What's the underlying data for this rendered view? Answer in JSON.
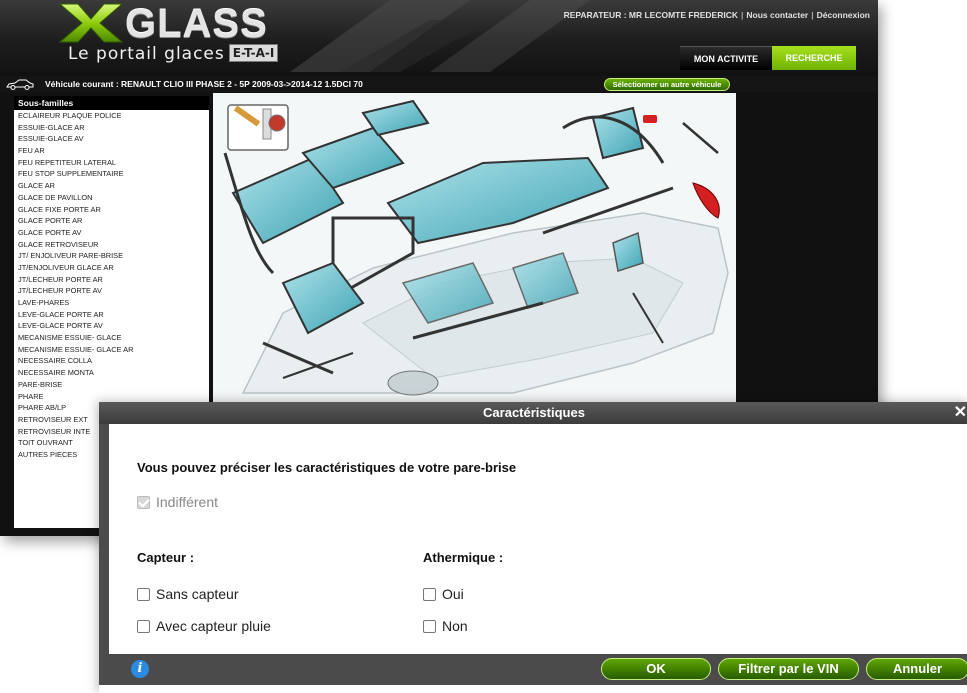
{
  "app": {
    "logo_text": "GLASS",
    "logo_subtitle": "Le portail glaces",
    "logo_badge": "E-T-A-I",
    "top_links": {
      "repairer": "REPARATEUR : MR LECOMTE FREDERICK",
      "contact": "Nous contacter",
      "logout": "Déconnexion"
    },
    "tabs": {
      "activite": "MON ACTIVITE",
      "recherche": "RECHERCHE"
    },
    "vehicle": {
      "label": "Véhicule courant : RENAULT CLIO III PHASE 2 - 5P 2009-03->2014-12 1.5DCI 70",
      "select_button": "Sélectionner un autre véhicule"
    },
    "sidebar": {
      "title": "Sous-familles",
      "items": [
        "ECLAIREUR PLAQUE POLICE",
        "ESSUIE-GLACE AR",
        "ESSUIE-GLACE AV",
        "FEU AR",
        "FEU REPETITEUR LATERAL",
        "FEU STOP SUPPLEMENTAIRE",
        "GLACE AR",
        "GLACE DE PAVILLON",
        "GLACE FIXE PORTE AR",
        "GLACE PORTE AR",
        "GLACE PORTE AV",
        "GLACE RETROVISEUR",
        "JT/ ENJOLIVEUR PARE-BRISE",
        "JT/ENJOLIVEUR GLACE AR",
        "JT/LECHEUR PORTE AR",
        "JT/LECHEUR PORTE AV",
        "LAVE-PHARES",
        "LEVE-GLACE PORTE AR",
        "LEVE-GLACE PORTE AV",
        "MECANISME ESSUIE- GLACE",
        "MECANISME ESSUIE- GLACE AR",
        "NECESSAIRE COLLA",
        "NECESSAIRE MONTA",
        "PARE-BRISE",
        "PHARE",
        "PHARE AB/LP",
        "RETROVISEUR EXT",
        "RETROVISEUR INTE",
        "TOIT OUVRANT",
        "AUTRES PIECES"
      ]
    }
  },
  "modal": {
    "title": "Caractéristiques",
    "close": "✕",
    "intro": "Vous pouvez préciser les caractéristiques de votre pare-brise",
    "indifferent": {
      "label": "Indifférent",
      "checked": true
    },
    "capteur": {
      "label": "Capteur :",
      "options": [
        "Sans capteur",
        "Avec capteur pluie"
      ]
    },
    "athermique": {
      "label": "Athermique :",
      "options": [
        "Oui",
        "Non"
      ]
    },
    "buttons": {
      "ok": "OK",
      "vin": "Filtrer par le VIN",
      "cancel": "Annuler"
    },
    "info_icon": "i"
  },
  "colors": {
    "accent_green": "#7cc400",
    "header_dark": "#1c1c1c",
    "modal_title": "#4b4b4b",
    "info_blue": "#2b8be0"
  }
}
